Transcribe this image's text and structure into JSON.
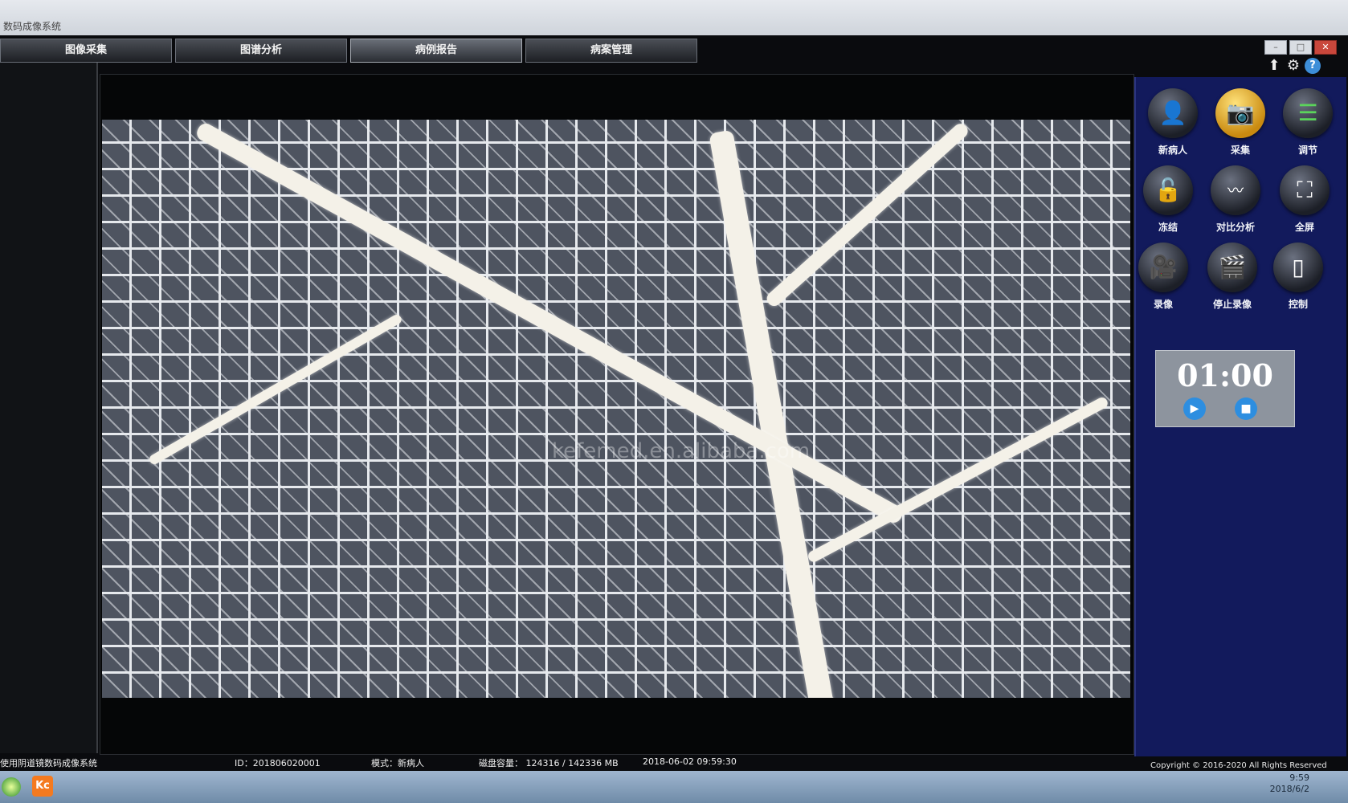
{
  "window": {
    "title": "数码成像系统"
  },
  "tabs": [
    {
      "label": "图像采集",
      "active": false
    },
    {
      "label": "图谱分析",
      "active": false
    },
    {
      "label": "病例报告",
      "active": true
    },
    {
      "label": "病案管理",
      "active": false
    }
  ],
  "viewer": {
    "watermark": "kefemed.en.alibaba.com"
  },
  "tools": [
    {
      "label": "新病人",
      "icon": "person-icon"
    },
    {
      "label": "采集",
      "icon": "camera-icon"
    },
    {
      "label": "调节",
      "icon": "sliders-icon"
    },
    {
      "label": "冻结",
      "icon": "unlock-icon"
    },
    {
      "label": "对比分析",
      "icon": "compare-icon"
    },
    {
      "label": "全屏",
      "icon": "fullscreen-icon"
    },
    {
      "label": "录像",
      "icon": "video-camera-icon"
    },
    {
      "label": "停止录像",
      "icon": "stop-record-icon"
    },
    {
      "label": "控制",
      "icon": "remote-icon"
    }
  ],
  "timer": {
    "time": "01:00"
  },
  "copyright": "Copyright © 2016-2020 All Rights Reserved",
  "statusbar": {
    "app": "使用阴道镜数码成像系统",
    "id": "ID：201806020001",
    "mode": "模式：新病人",
    "disk": "磁盘容量：   124316 / 142336 MB",
    "datetime": "2018-06-02  09:59:30"
  },
  "taskbar": {
    "kc_label": "Kc",
    "time": "9:59",
    "date": "2018/6/2"
  },
  "colors": {
    "accent_panel": "#121a5c",
    "play_blue": "#2d8ee0"
  }
}
